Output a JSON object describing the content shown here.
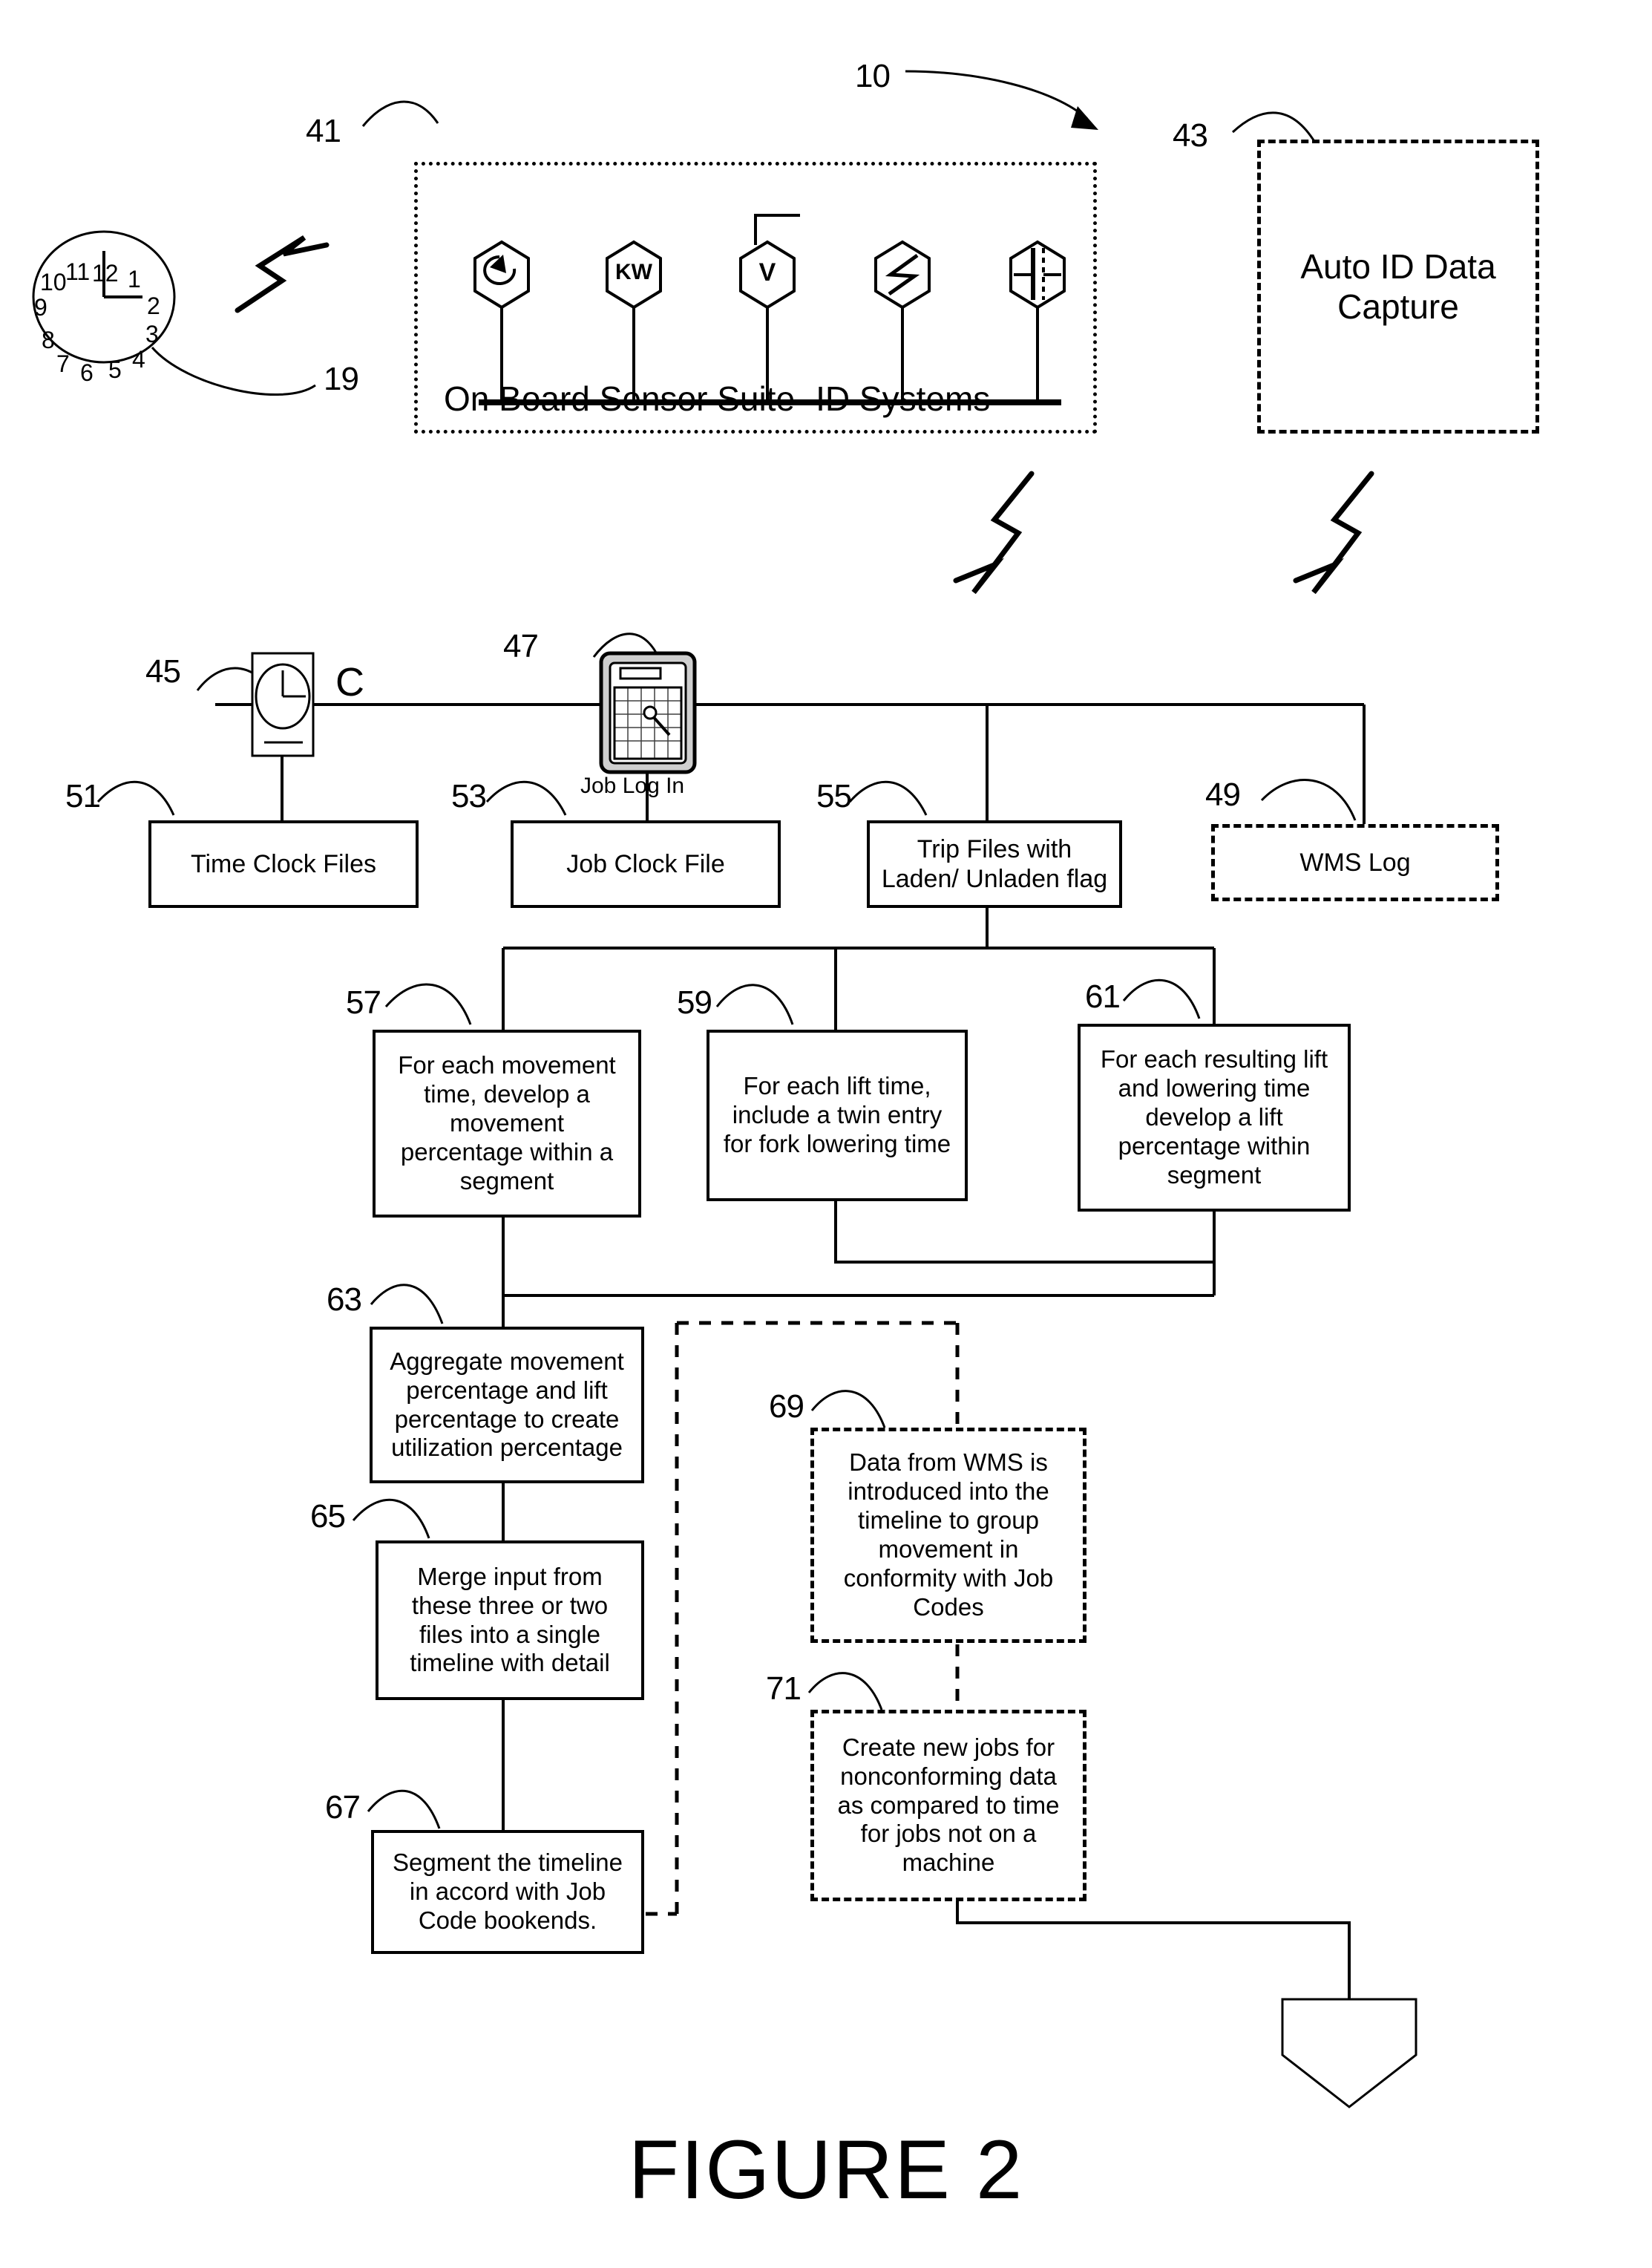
{
  "figure": {
    "caption": "FIGURE 2",
    "system_ref": "10"
  },
  "clock": {
    "ref": "19",
    "hour_numbers": [
      "12",
      "1",
      "2",
      "3",
      "4",
      "5",
      "6",
      "7",
      "8",
      "9",
      "10",
      "11"
    ]
  },
  "sensor_suite": {
    "ref": "41",
    "label": "On Board Sensor Suite -ID Systems",
    "sensors": [
      {
        "name": "rotation-sensor",
        "glyph": "",
        "icon": "rotation-arrow-icon"
      },
      {
        "name": "kilowatt-sensor",
        "glyph": "KW",
        "icon": "kw-text-icon"
      },
      {
        "name": "voltage-sensor",
        "glyph": "V",
        "icon": "voltage-text-icon"
      },
      {
        "name": "current-sensor",
        "glyph": "",
        "icon": "lightning-bolt-icon"
      },
      {
        "name": "capacitance-sensor",
        "glyph": "",
        "icon": "capacitor-icon"
      }
    ]
  },
  "auto_id": {
    "ref": "43",
    "line1": "Auto ID Data",
    "line2": "Capture"
  },
  "time_clock_device": {
    "ref": "45",
    "marker": "C"
  },
  "job_log_device": {
    "ref": "47",
    "label": "Job Log In"
  },
  "file_boxes": [
    {
      "ref": "51",
      "name": "time-clock-files",
      "text": "Time Clock Files",
      "style": "solid"
    },
    {
      "ref": "53",
      "name": "job-clock-file",
      "text": "Job Clock File",
      "style": "solid"
    },
    {
      "ref": "55",
      "name": "trip-files",
      "text": "Trip Files with Laden/ Unladen flag",
      "style": "solid"
    },
    {
      "ref": "49",
      "name": "wms-log",
      "text": "WMS Log",
      "style": "dashed"
    }
  ],
  "process_boxes": [
    {
      "ref": "57",
      "name": "movement-percentage-step",
      "text": "For each movement time, develop a movement percentage within a segment",
      "style": "solid"
    },
    {
      "ref": "59",
      "name": "twin-entry-step",
      "text": "For each lift time, include a twin entry for fork lowering time",
      "style": "solid"
    },
    {
      "ref": "61",
      "name": "lift-percentage-step",
      "text": "For each resulting lift and lowering time develop a lift percentage within segment",
      "style": "solid"
    },
    {
      "ref": "63",
      "name": "aggregate-utilization-step",
      "text": "Aggregate movement percentage and lift percentage to create utilization percentage",
      "style": "solid"
    },
    {
      "ref": "65",
      "name": "merge-timeline-step",
      "text": "Merge input from these three or two files into a single timeline with detail",
      "style": "solid"
    },
    {
      "ref": "67",
      "name": "segment-timeline-step",
      "text": "Segment the timeline in accord with Job Code bookends.",
      "style": "solid"
    },
    {
      "ref": "69",
      "name": "wms-grouping-step",
      "text": "Data from WMS is introduced into the timeline to group movement in conformity with Job Codes",
      "style": "dashed"
    },
    {
      "ref": "71",
      "name": "nonconforming-jobs-step",
      "text": "Create new jobs for nonconforming data as compared to time for jobs not on a machine",
      "style": "dashed"
    }
  ],
  "colors": {
    "ink": "#000000",
    "paper": "#ffffff"
  }
}
